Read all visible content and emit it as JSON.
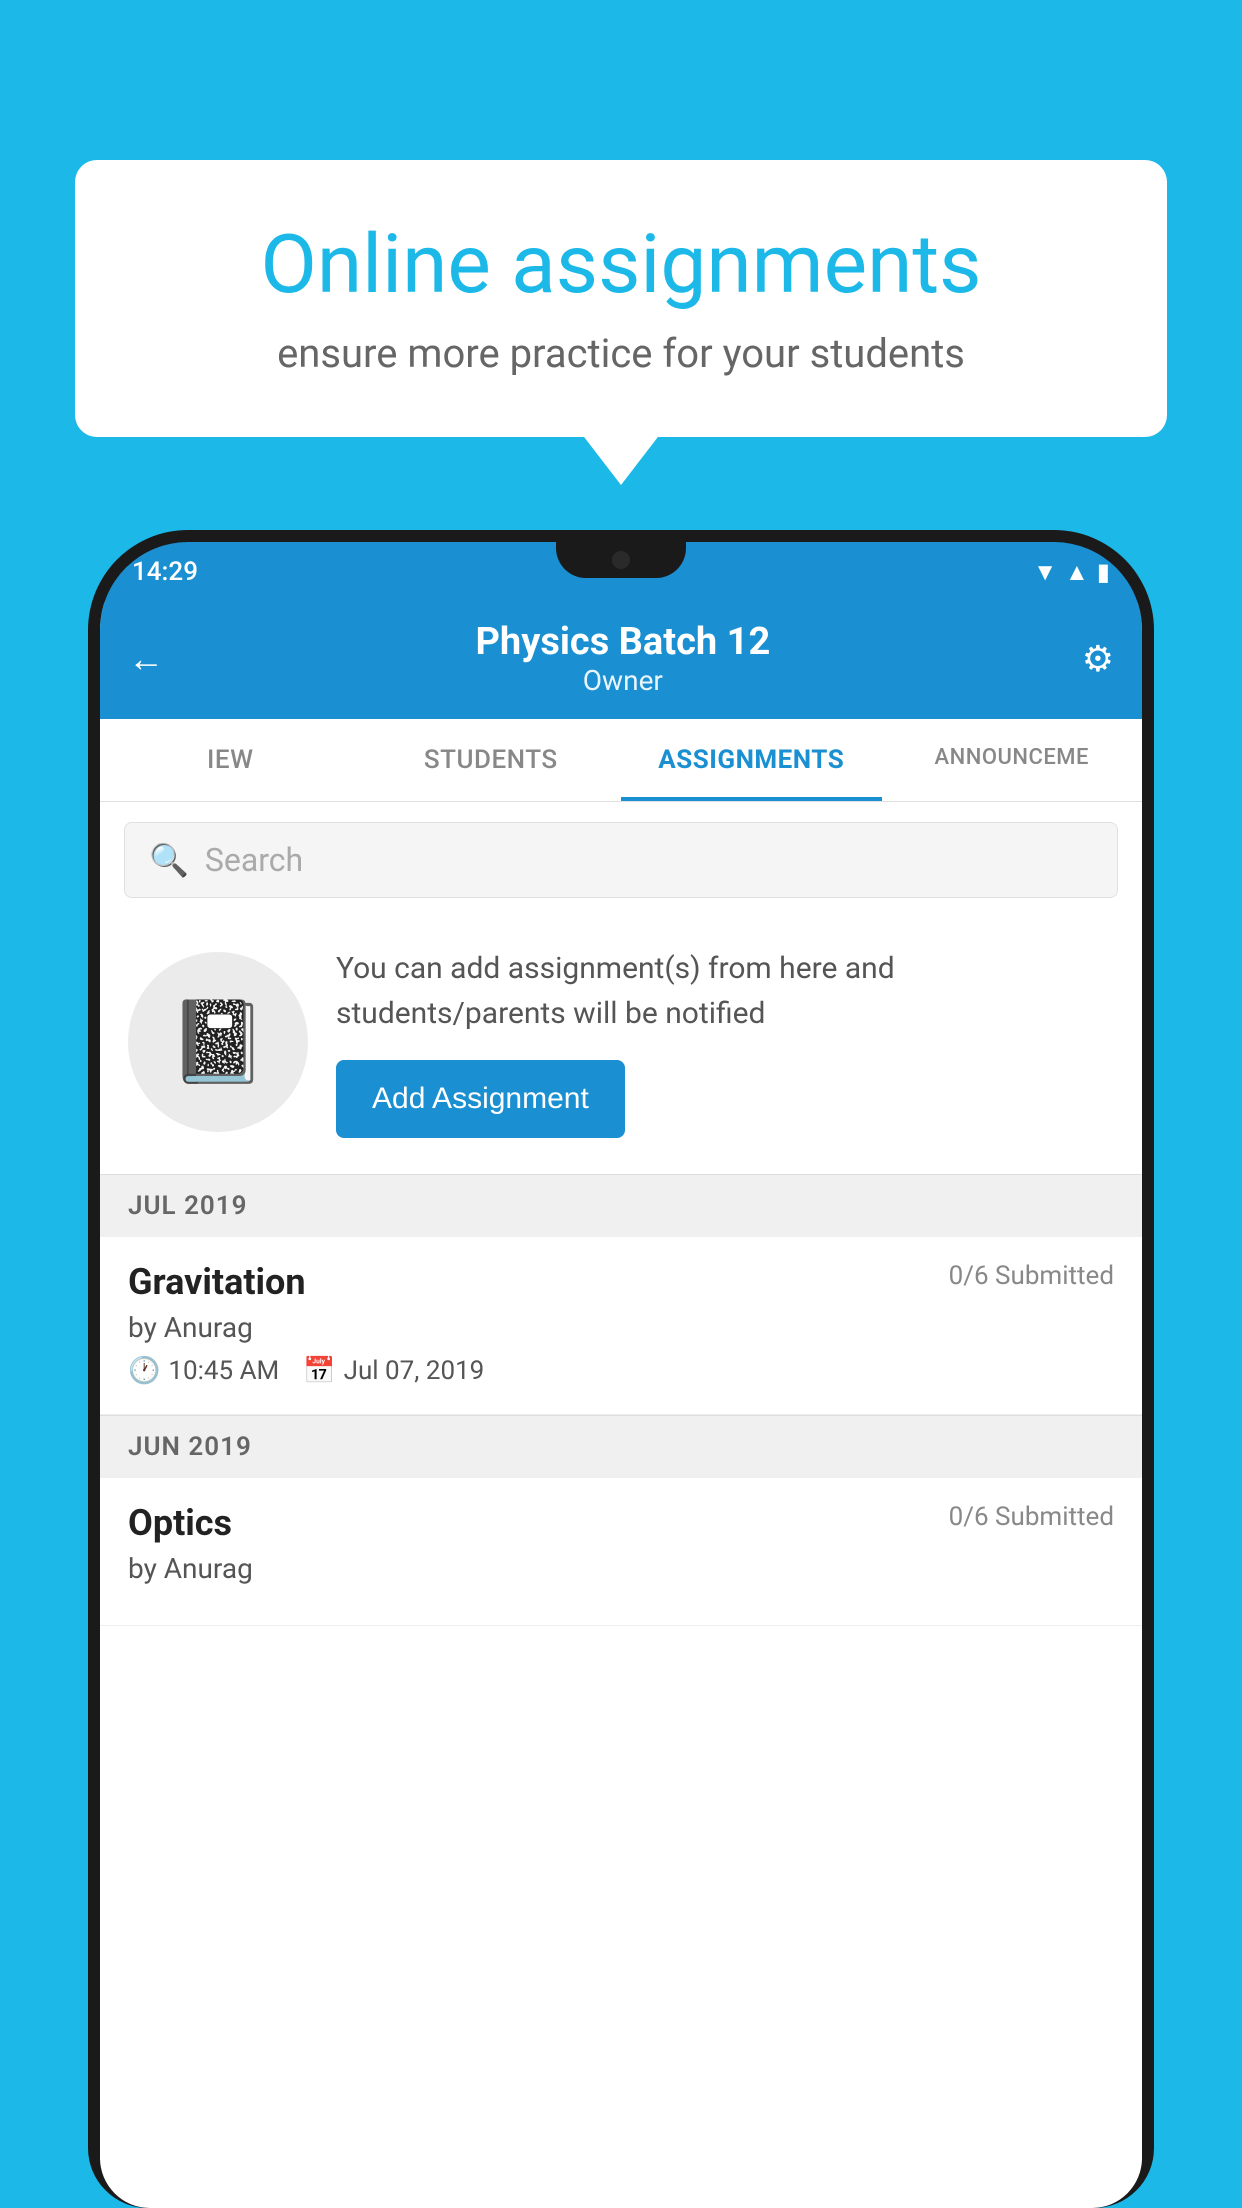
{
  "background_color": "#1bb8e8",
  "speech_bubble": {
    "title": "Online assignments",
    "subtitle": "ensure more practice for your students"
  },
  "phone": {
    "status_bar": {
      "time": "14:29",
      "signal_icon": "▲",
      "wifi_icon": "▼"
    },
    "header": {
      "title": "Physics Batch 12",
      "subtitle": "Owner",
      "back_icon": "←",
      "settings_icon": "⚙"
    },
    "tabs": [
      {
        "label": "IEW",
        "active": false
      },
      {
        "label": "STUDENTS",
        "active": false
      },
      {
        "label": "ASSIGNMENTS",
        "active": true
      },
      {
        "label": "ANNOUNCEME",
        "active": false
      }
    ],
    "search": {
      "placeholder": "Search"
    },
    "info_card": {
      "description": "You can add assignment(s) from here and students/parents will be notified",
      "button_label": "Add Assignment"
    },
    "sections": [
      {
        "month": "JUL 2019",
        "assignments": [
          {
            "title": "Gravitation",
            "submitted": "0/6 Submitted",
            "author": "by Anurag",
            "time": "10:45 AM",
            "date": "Jul 07, 2019"
          }
        ]
      },
      {
        "month": "JUN 2019",
        "assignments": [
          {
            "title": "Optics",
            "submitted": "0/6 Submitted",
            "author": "by Anurag",
            "time": "",
            "date": ""
          }
        ]
      }
    ]
  }
}
